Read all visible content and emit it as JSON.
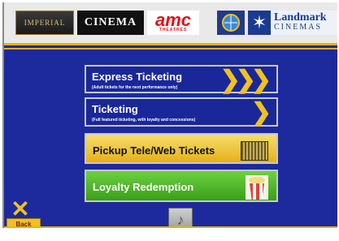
{
  "header": {
    "logos": {
      "imperial": "IMPERIAL",
      "cinema": "CINEMA",
      "amc_top": "amc",
      "amc_bottom": "THEATRES",
      "landmark_1": "Landmark",
      "landmark_2": "CINEMAS"
    }
  },
  "menu": {
    "express": {
      "title": "Express Ticketing",
      "subtitle": "(Adult tickets for the next performance only)"
    },
    "ticketing": {
      "title": "Ticketing",
      "subtitle": "(Full featured ticketing, with loyalty and concessions)"
    },
    "pickup": {
      "title": "Pickup Tele/Web Tickets"
    },
    "loyalty": {
      "title": "Loyalty Redemption"
    }
  },
  "footer": {
    "back_label": "Back"
  },
  "colors": {
    "background": "#1c2a9e",
    "accent_gold": "#f2c21a",
    "pickup_button": "#e6b01a",
    "loyalty_button": "#3a9e18"
  },
  "icons": {
    "express_chevrons": "triple-chevron-right-icon",
    "ticketing_chevron": "chevron-right-icon",
    "pickup": "ticket-stub-icon",
    "loyalty": "popcorn-icon",
    "music": "music-note-icon",
    "close": "close-x-icon"
  }
}
